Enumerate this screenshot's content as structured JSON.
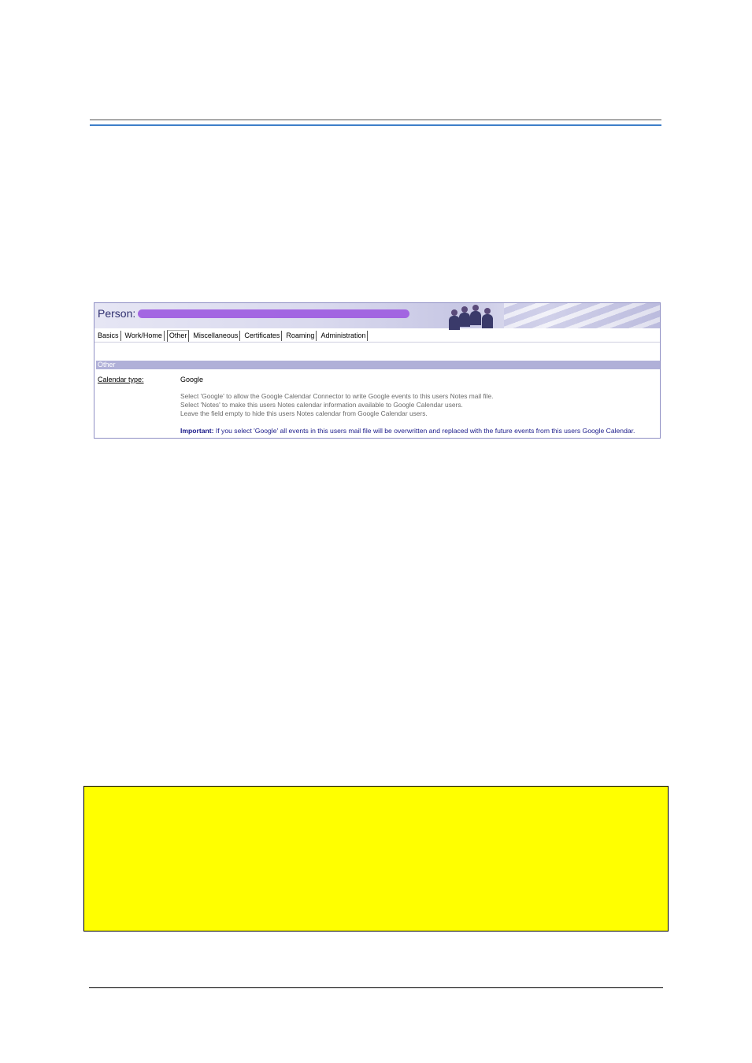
{
  "screenshot": {
    "person_label": "Person:",
    "tabs": [
      {
        "label": "Basics"
      },
      {
        "label": "Work/Home"
      },
      {
        "label": "Other"
      },
      {
        "label": "Miscellaneous"
      },
      {
        "label": "Certificates"
      },
      {
        "label": "Roaming"
      },
      {
        "label": "Administration"
      }
    ],
    "active_tab": "Other",
    "section_title": "Other",
    "field": {
      "label": "Calendar type:",
      "value": "Google"
    },
    "help_lines": [
      "Select 'Google' to allow the Google Calendar Connector to write Google events to this users Notes mail file.",
      "Select 'Notes' to make this users Notes calendar information available to Google Calendar users.",
      "Leave the field empty to hide this users Notes calendar from Google Calendar users."
    ],
    "important_label": "Important:",
    "important_text": " If you select 'Google' all events in this users mail file will be overwritten and replaced with the future events from this users Google Calendar."
  },
  "colors": {
    "header_rule": "#3d7fc9",
    "section_bar": "#b0b0d8",
    "note_box": "#ffff00",
    "redaction": "#9f5fe0"
  }
}
